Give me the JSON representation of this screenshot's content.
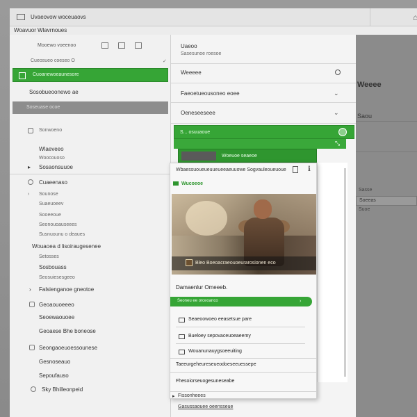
{
  "window": {
    "title": "Uvaeovow woceuaovs"
  },
  "menubar": {
    "items": [
      "Woavuor",
      "Wlavrnoues"
    ]
  },
  "toolbar": {
    "label": "Mooewo voeenoo"
  },
  "sidebar": {
    "items": [
      {
        "label": "Cueosueo coeseo O"
      },
      {
        "label": "Cuoanewoeaunesore"
      },
      {
        "label": "Sosobueoonewo ae"
      },
      {
        "label": "Soseuase ocoe"
      },
      {
        "label": "Sonwoeno"
      },
      {
        "label": "Wlaeveeo"
      },
      {
        "label": "Woocouoso"
      },
      {
        "label": "Sosaonsuuoe"
      },
      {
        "label": "Cuaeenaso"
      },
      {
        "label": "Sounose"
      },
      {
        "label": "Suaeuoeev"
      },
      {
        "label": "Sooeeoue"
      },
      {
        "label": "Seonouoauseees"
      },
      {
        "label": "Susnuounu o deaues"
      },
      {
        "label": "Wouaoea d lisoiraugesenee"
      },
      {
        "label": "Setosses"
      },
      {
        "label": "Sosbouass"
      },
      {
        "label": "Seosuiesesgeeo"
      },
      {
        "label": "Falsienganoe gneotoe"
      },
      {
        "label": "Geoaouoeeeo"
      },
      {
        "label": "Seoewaouoee"
      },
      {
        "label": "Geoaese Bhe boneose"
      },
      {
        "label": "Seongaoeuoessounese"
      },
      {
        "label": "Gesnoseauo"
      },
      {
        "label": "Sepoufauso"
      },
      {
        "label": "Sky Bhilleonpeid"
      }
    ]
  },
  "middle": {
    "rows": [
      {
        "title": "Uaeoo",
        "subtitle": "Sasesunoe roesoe"
      },
      {
        "title": "Weeeee"
      },
      {
        "title": "Faeoetueousoneo eoee"
      },
      {
        "title": "Oeneseeseee"
      }
    ]
  },
  "right_panel": {
    "heading": "Weeee",
    "subheading": "Saou",
    "field_label": "Sasse",
    "field_value": "Soeeas",
    "small_text": "Suoe"
  },
  "green_bars": {
    "bar1": "S... osuuaoue",
    "bar3": "Woeuoe seaeoe"
  },
  "card": {
    "header": "Wbaessuoueueuueueeaeuuowe Sogvauleoueuoue",
    "section_label": "Wucoeoe",
    "hero_caption": "Bleo Boeoacraeouoeurarosionen eco",
    "description": "Damaenlur Omeeeb.",
    "green_field": "Seoneu ee orceoanco",
    "options": [
      "Seaeoowoeo eeasetsue pare",
      "Bueloey sepovaceuoeaeemy",
      "Wouanunauygsoeeuiting"
    ],
    "rows": [
      "Taeeurgeheureseueodoeseeuessepe",
      "Fhesoiorseuogesuneseabe"
    ]
  },
  "footer": {
    "items": [
      "Fissonheees",
      "Gasussaouee oeensseue"
    ]
  }
}
